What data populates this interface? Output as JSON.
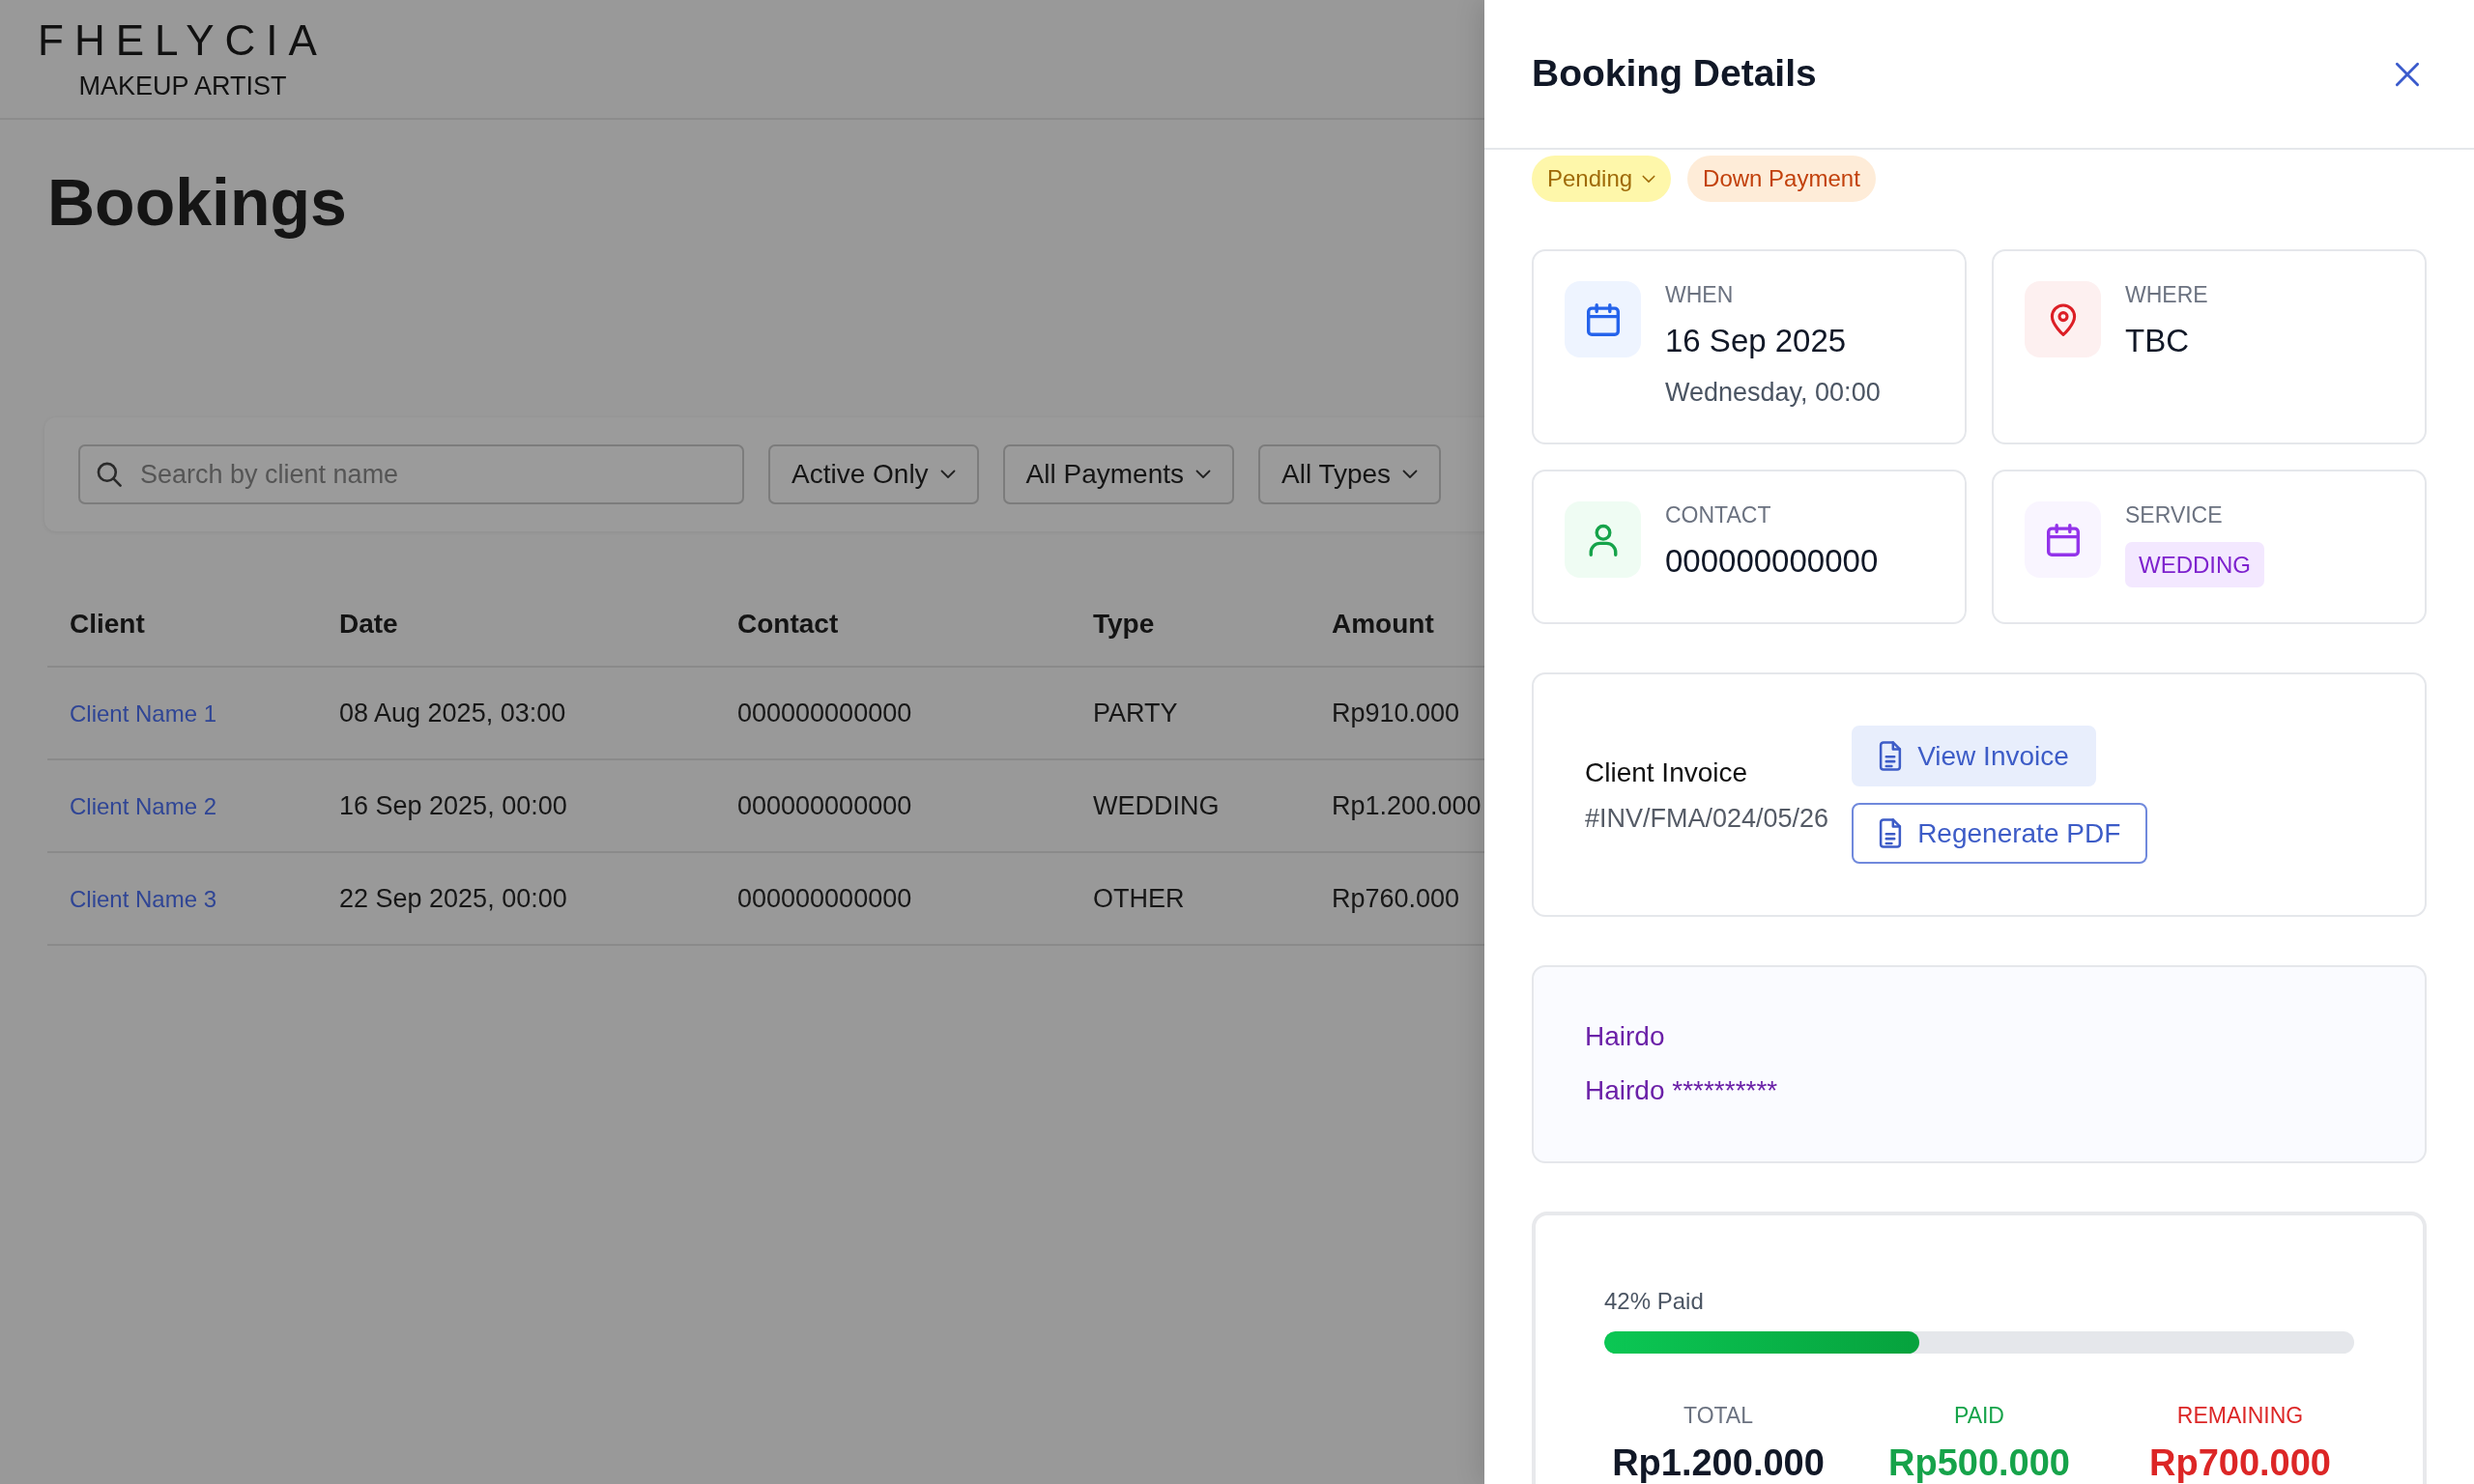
{
  "brand": {
    "name": "FHELYCIA",
    "tagline": "MAKEUP ARTIST"
  },
  "page": {
    "title": "Bookings"
  },
  "filters": {
    "search": {
      "placeholder": "Search by client name"
    },
    "dropdowns": [
      "Active Only",
      "All Payments",
      "All Types"
    ]
  },
  "table": {
    "columns": [
      "Client",
      "Date",
      "Contact",
      "Type",
      "Amount"
    ],
    "rows": [
      [
        "Client Name 1",
        "08 Aug 2025, 03:00",
        "000000000000",
        "PARTY",
        "Rp910.000"
      ],
      [
        "Client Name 2",
        "16 Sep 2025, 00:00",
        "000000000000",
        "WEDDING",
        "Rp1.200.000"
      ],
      [
        "Client Name 3",
        "22 Sep 2025, 00:00",
        "000000000000",
        "OTHER",
        "Rp760.000"
      ]
    ]
  },
  "details_panel": {
    "title": "Booking Details",
    "badges": [
      {
        "kind": "status",
        "label": "Pending"
      },
      {
        "kind": "payment",
        "label": "Down Payment"
      }
    ],
    "info_cards": [
      {
        "kind": "date",
        "label": "WHEN",
        "value": "16 Sep 2025",
        "detail": "Wednesday, 00:00"
      },
      {
        "kind": "location",
        "label": "WHERE",
        "value": "TBC"
      },
      {
        "kind": "contact",
        "label": "CONTACT",
        "value": "000000000000"
      },
      {
        "kind": "service",
        "label": "SERVICE",
        "tag": "WEDDING"
      }
    ],
    "invoice": {
      "title": "Client Invoice",
      "number": "#INV/FMA/024/05/26",
      "buttons": [
        {
          "kind": "view",
          "label": "View Invoice"
        },
        {
          "kind": "regenerate",
          "label": "Regenerate PDF"
        }
      ]
    },
    "notes": {
      "lines": [
        "Hairdo",
        "Hairdo **********"
      ]
    },
    "payment": {
      "progress_label": "42% Paid",
      "level": 0.42,
      "stats": [
        {
          "kind": "total",
          "label": "TOTAL",
          "value": "Rp1.200.000"
        },
        {
          "kind": "paid",
          "label": "PAID",
          "value": "Rp500.000"
        },
        {
          "kind": "remaining",
          "label": "REMAINING",
          "value": "Rp700.000"
        }
      ]
    }
  }
}
